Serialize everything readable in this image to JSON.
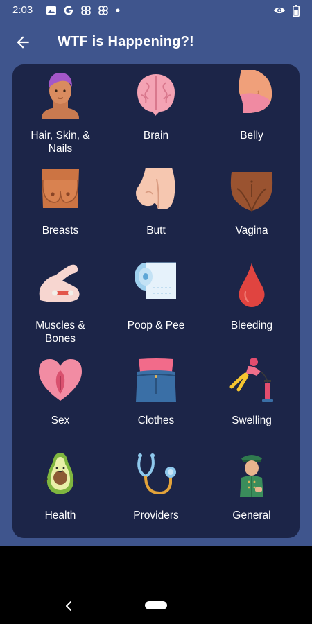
{
  "status_bar": {
    "time": "2:03",
    "left_icons": [
      "image-icon",
      "google-icon",
      "pinwheel-icon",
      "pinwheel-icon",
      "dot-icon"
    ],
    "right_icons": [
      "eye-icon",
      "battery-icon"
    ]
  },
  "app_bar": {
    "title": "WTF is Happening?!",
    "back_icon": "back-arrow-icon"
  },
  "grid": {
    "items": [
      {
        "label": "Hair, Skin, &\nNails",
        "icon": "face-icon"
      },
      {
        "label": "Brain",
        "icon": "brain-icon"
      },
      {
        "label": "Belly",
        "icon": "belly-icon"
      },
      {
        "label": "Breasts",
        "icon": "breasts-icon"
      },
      {
        "label": "Butt",
        "icon": "butt-icon"
      },
      {
        "label": "Vagina",
        "icon": "vagina-icon"
      },
      {
        "label": "Muscles &\nBones",
        "icon": "flexed-arm-icon"
      },
      {
        "label": "Poop & Pee",
        "icon": "toilet-paper-icon"
      },
      {
        "label": "Bleeding",
        "icon": "blood-drop-icon"
      },
      {
        "label": "Sex",
        "icon": "heart-icon"
      },
      {
        "label": "Clothes",
        "icon": "jeans-icon"
      },
      {
        "label": "Swelling",
        "icon": "balloon-pump-icon"
      },
      {
        "label": "Health",
        "icon": "avocado-icon"
      },
      {
        "label": "Providers",
        "icon": "stethoscope-icon"
      },
      {
        "label": "General",
        "icon": "general-icon"
      }
    ]
  },
  "colors": {
    "background": "#3f558d",
    "card": "#1c2548",
    "text": "#ffffff",
    "nav_bar": "#000000"
  }
}
